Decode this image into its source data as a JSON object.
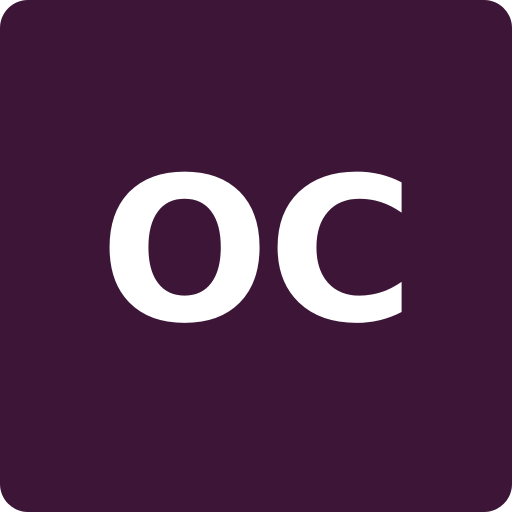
{
  "avatar": {
    "initials": "OC",
    "background_color": "#3d1637",
    "text_color": "#ffffff"
  }
}
